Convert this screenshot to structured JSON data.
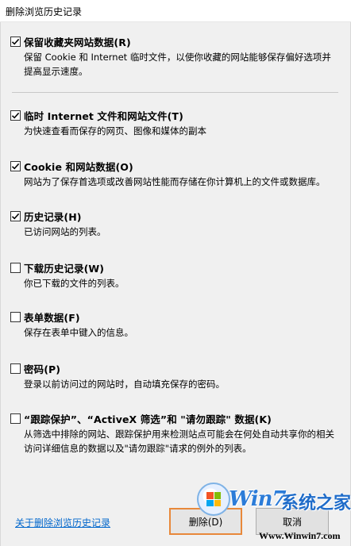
{
  "window": {
    "title": "删除浏览历史记录"
  },
  "options": [
    {
      "checked": true,
      "label": "保留收藏夹网站数据(R)",
      "desc": "保留 Cookie 和 Internet 临时文件，以使你收藏的网站能够保存偏好选项并提高显示速度。"
    },
    {
      "checked": true,
      "label": "临时 Internet 文件和网站文件(T)",
      "desc": "为快速查看而保存的网页、图像和媒体的副本"
    },
    {
      "checked": true,
      "label": "Cookie 和网站数据(O)",
      "desc": "网站为了保存首选项或改善网站性能而存储在你计算机上的文件或数据库。"
    },
    {
      "checked": true,
      "label": "历史记录(H)",
      "desc": "已访问网站的列表。"
    },
    {
      "checked": false,
      "label": "下载历史记录(W)",
      "desc": "你已下载的文件的列表。"
    },
    {
      "checked": false,
      "label": "表单数据(F)",
      "desc": "保存在表单中键入的信息。"
    },
    {
      "checked": false,
      "label": "密码(P)",
      "desc": "登录以前访问过的网站时，自动填充保存的密码。"
    },
    {
      "checked": false,
      "label": "“跟踪保护”、“ActiveX 筛选”和 \"请勿跟踪\" 数据(K)",
      "desc": "从筛选中排除的网站、跟踪保护用来检测站点可能会在何处自动共享你的相关访问详细信息的数据以及\"请勿跟踪\"请求的例外的列表。"
    }
  ],
  "footer": {
    "about_link": "关于删除浏览历史记录",
    "delete_button": "删除(D)",
    "cancel_button": "取消"
  },
  "watermark": {
    "brand": "Win7",
    "brand_cn": "系统之家",
    "url": "Www.Winwin7.com"
  },
  "colors": {
    "link": "#0066cc",
    "accent_border": "#e8883a",
    "watermark_blue": "#2c7cd8"
  }
}
